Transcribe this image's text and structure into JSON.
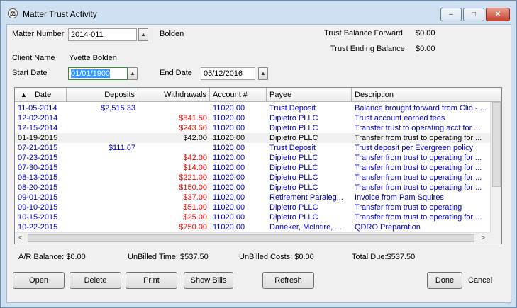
{
  "window": {
    "title": "Matter Trust Activity",
    "icon_name": "app-logo-icon",
    "minimize": "▭",
    "maximize": "□",
    "close": "✕"
  },
  "form": {
    "matter_number_label": "Matter Number",
    "matter_number_value": "2014-011",
    "matter_name": "Bolden",
    "client_name_label": "Client Name",
    "client_name_value": "Yvette Bolden",
    "start_date_label": "Start Date",
    "start_date_value": "01/01/1900",
    "end_date_label": "End Date",
    "end_date_value": "05/12/2016",
    "tb_forward_label": "Trust Balance Forward",
    "tb_forward_value": "$0.00",
    "tb_ending_label": "Trust Ending Balance",
    "tb_ending_value": "$0.00"
  },
  "table": {
    "sort_indicator": "▲",
    "columns": [
      "Date",
      "Deposits",
      "Withdrawals",
      "Account #",
      "Payee",
      "Description"
    ],
    "rows": [
      {
        "date": "11-05-2014",
        "deposits": "$2,515.33",
        "withdrawals": "",
        "account": "11020.00",
        "payee": "Trust Deposit",
        "description": "Balance brought forward from Clio - ...",
        "style": "blue"
      },
      {
        "date": "12-02-2014",
        "deposits": "",
        "withdrawals": "$841.50",
        "account": "11020.00",
        "payee": "Dipietro PLLC",
        "description": "Trust account earned fees",
        "style": "blue"
      },
      {
        "date": "12-15-2014",
        "deposits": "",
        "withdrawals": "$243.50",
        "account": "11020.00",
        "payee": "Dipietro PLLC",
        "description": "Transfer trust to operating acct for ...",
        "style": "blue"
      },
      {
        "date": "01-19-2015",
        "deposits": "",
        "withdrawals": "$42.00",
        "account": "11020.00",
        "payee": "Dipietro PLLC",
        "description": "Transfer from trust to operating for ...",
        "style": "black"
      },
      {
        "date": "07-21-2015",
        "deposits": "$111.67",
        "withdrawals": "",
        "account": "11020.00",
        "payee": "Trust Deposit",
        "description": "Trust deposit per Evergreen policy",
        "style": "blue"
      },
      {
        "date": "07-23-2015",
        "deposits": "",
        "withdrawals": "$42.00",
        "account": "11020.00",
        "payee": "Dipietro PLLC",
        "description": "Transfer from trust to operating for ...",
        "style": "blue"
      },
      {
        "date": "07-30-2015",
        "deposits": "",
        "withdrawals": "$14.00",
        "account": "11020.00",
        "payee": "Dipietro PLLC",
        "description": "Transfer from trust to operating for ...",
        "style": "blue"
      },
      {
        "date": "08-13-2015",
        "deposits": "",
        "withdrawals": "$221.00",
        "account": "11020.00",
        "payee": "Dipietro PLLC",
        "description": "Transfer from trust to operating for ...",
        "style": "blue"
      },
      {
        "date": "08-20-2015",
        "deposits": "",
        "withdrawals": "$150.00",
        "account": "11020.00",
        "payee": "Dipietro PLLC",
        "description": "Transfer from trust to operating for ...",
        "style": "blue"
      },
      {
        "date": "09-01-2015",
        "deposits": "",
        "withdrawals": "$37.00",
        "account": "11020.00",
        "payee": "Retirement Paraleg...",
        "description": "Invoice from Pam Squires",
        "style": "blue"
      },
      {
        "date": "09-10-2015",
        "deposits": "",
        "withdrawals": "$51.00",
        "account": "11020.00",
        "payee": "Dipietro PLLC",
        "description": "Transfer from trust to operating",
        "style": "blue"
      },
      {
        "date": "10-15-2015",
        "deposits": "",
        "withdrawals": "$25.00",
        "account": "11020.00",
        "payee": "Dipietro PLLC",
        "description": "Transfer from trust to operating for ...",
        "style": "blue"
      },
      {
        "date": "10-22-2015",
        "deposits": "",
        "withdrawals": "$750.00",
        "account": "11020.00",
        "payee": "Daneker, McIntire, ...",
        "description": "QDRO Preparation",
        "style": "blue"
      }
    ]
  },
  "summary": {
    "ar_balance": "A/R Balance: $0.00",
    "unbilled_time": "UnBilled Time: $537.50",
    "unbilled_costs": "UnBilled Costs: $0.00",
    "total_due": "Total Due:$537.50"
  },
  "buttons": {
    "open": "Open",
    "delete": "Delete",
    "print": "Print",
    "show_bills": "Show Bills",
    "refresh": "Refresh",
    "done": "Done",
    "cancel": "Cancel"
  },
  "colors": {
    "blue_text": "#0000cc",
    "red_text": "#ff0000",
    "black_text": "#000000"
  }
}
